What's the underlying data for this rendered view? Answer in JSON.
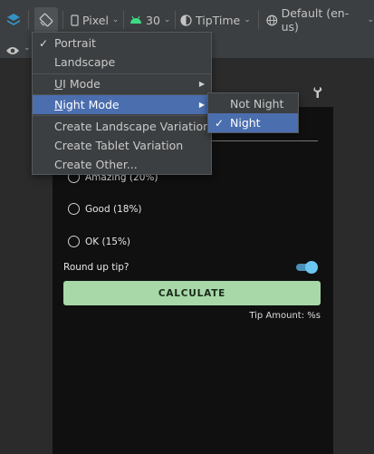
{
  "toolbar": {
    "device": "Pixel",
    "api_level": "30",
    "theme": "TipTime",
    "locale": "Default (en-us)"
  },
  "menu": {
    "items": [
      {
        "label": "Portrait",
        "checked": true
      },
      {
        "label": "Landscape"
      },
      {
        "label": "UI Mode",
        "mnemonic": "U",
        "rest": "I Mode",
        "has_submenu": true
      },
      {
        "label": "Night Mode",
        "mnemonic": "N",
        "rest": "ight Mode",
        "has_submenu": true,
        "highlighted": true
      },
      {
        "label": "Create Landscape Variation"
      },
      {
        "label": "Create Tablet Variation"
      },
      {
        "label": "Create Other..."
      }
    ]
  },
  "submenu": {
    "items": [
      {
        "label": "Not Night"
      },
      {
        "label": "Night",
        "checked": true,
        "highlighted": true
      }
    ]
  },
  "preview": {
    "options": [
      "Amazing (20%)",
      "Good (18%)",
      "OK (15%)"
    ],
    "round_up_label": "Round up tip?",
    "round_up_enabled": true,
    "calculate_label": "CALCULATE",
    "tip_amount": "Tip Amount: %s"
  },
  "colors": {
    "selection": "#4b6eaf",
    "button": "#a8d8a8",
    "toggle": "#6cc6f2",
    "android_green": "#3ddc84"
  }
}
